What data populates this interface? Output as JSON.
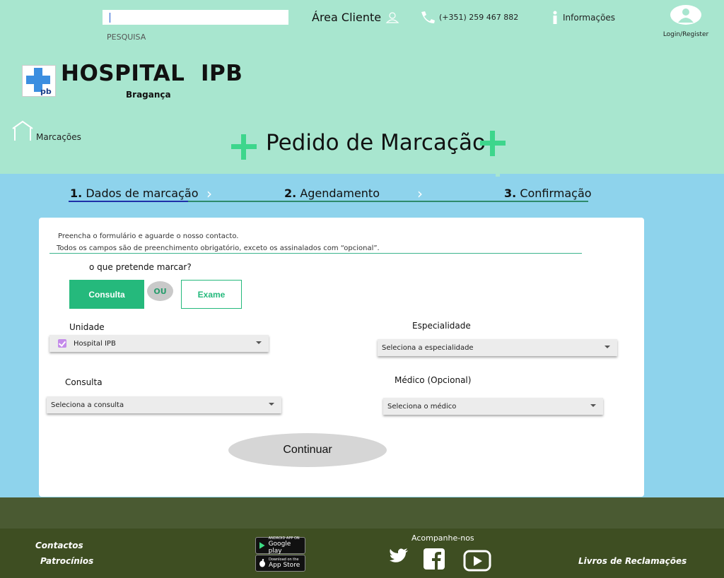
{
  "header": {
    "search_placeholder": "",
    "search_label": "PESQUISA",
    "area_cliente": "Área Cliente",
    "phone": "(+351) 259 467 882",
    "info": "Informações",
    "login": "Login/Register",
    "logo_title": "HOSPITAL  IPB",
    "logo_subtitle": "Bragança",
    "home_label": "Marcações",
    "page_title": "Pedido de Marcação"
  },
  "steps": [
    {
      "num": "1.",
      "label": "Dados de marcação",
      "active": true
    },
    {
      "num": "2.",
      "label": "Agendamento",
      "active": false
    },
    {
      "num": "3.",
      "label": "Confirmação",
      "active": false
    }
  ],
  "form": {
    "intro1": "Preencha o formulário e aguarde o nosso contacto.",
    "intro2": "Todos os campos são de preenchimento obrigatório, exceto os assinalados com “opcional”.",
    "question": "o que pretende marcar?",
    "consulta_button": "Consulta",
    "ou": "OU",
    "exame_button": "Exame",
    "unidade_label": "Unidade",
    "unidade_value": "Hospital IPB",
    "especialidade_label": "Especialidade",
    "especialidade_value": "Seleciona a especialidade",
    "consulta_label": "Consulta",
    "consulta_value": "Seleciona a consulta",
    "medico_label": "Médico (Opcional)",
    "medico_value": "Seleciona o médico",
    "continue_button": "Continuar"
  },
  "footer": {
    "contactos": "Contactos",
    "patrocinios": "Patrocínios",
    "google_play_small": "ANDROID APP ON",
    "google_play": "Google play",
    "app_store_small": "Download on the",
    "app_store": "App Store",
    "follow": "Acompanhe-nos",
    "livros": "Livros de Reclamações"
  },
  "colors": {
    "header_bg": "#a8e6cf",
    "page_bg": "#8ed3ec",
    "accent_green": "#25b97c",
    "footer_bg": "#3e4e22"
  }
}
